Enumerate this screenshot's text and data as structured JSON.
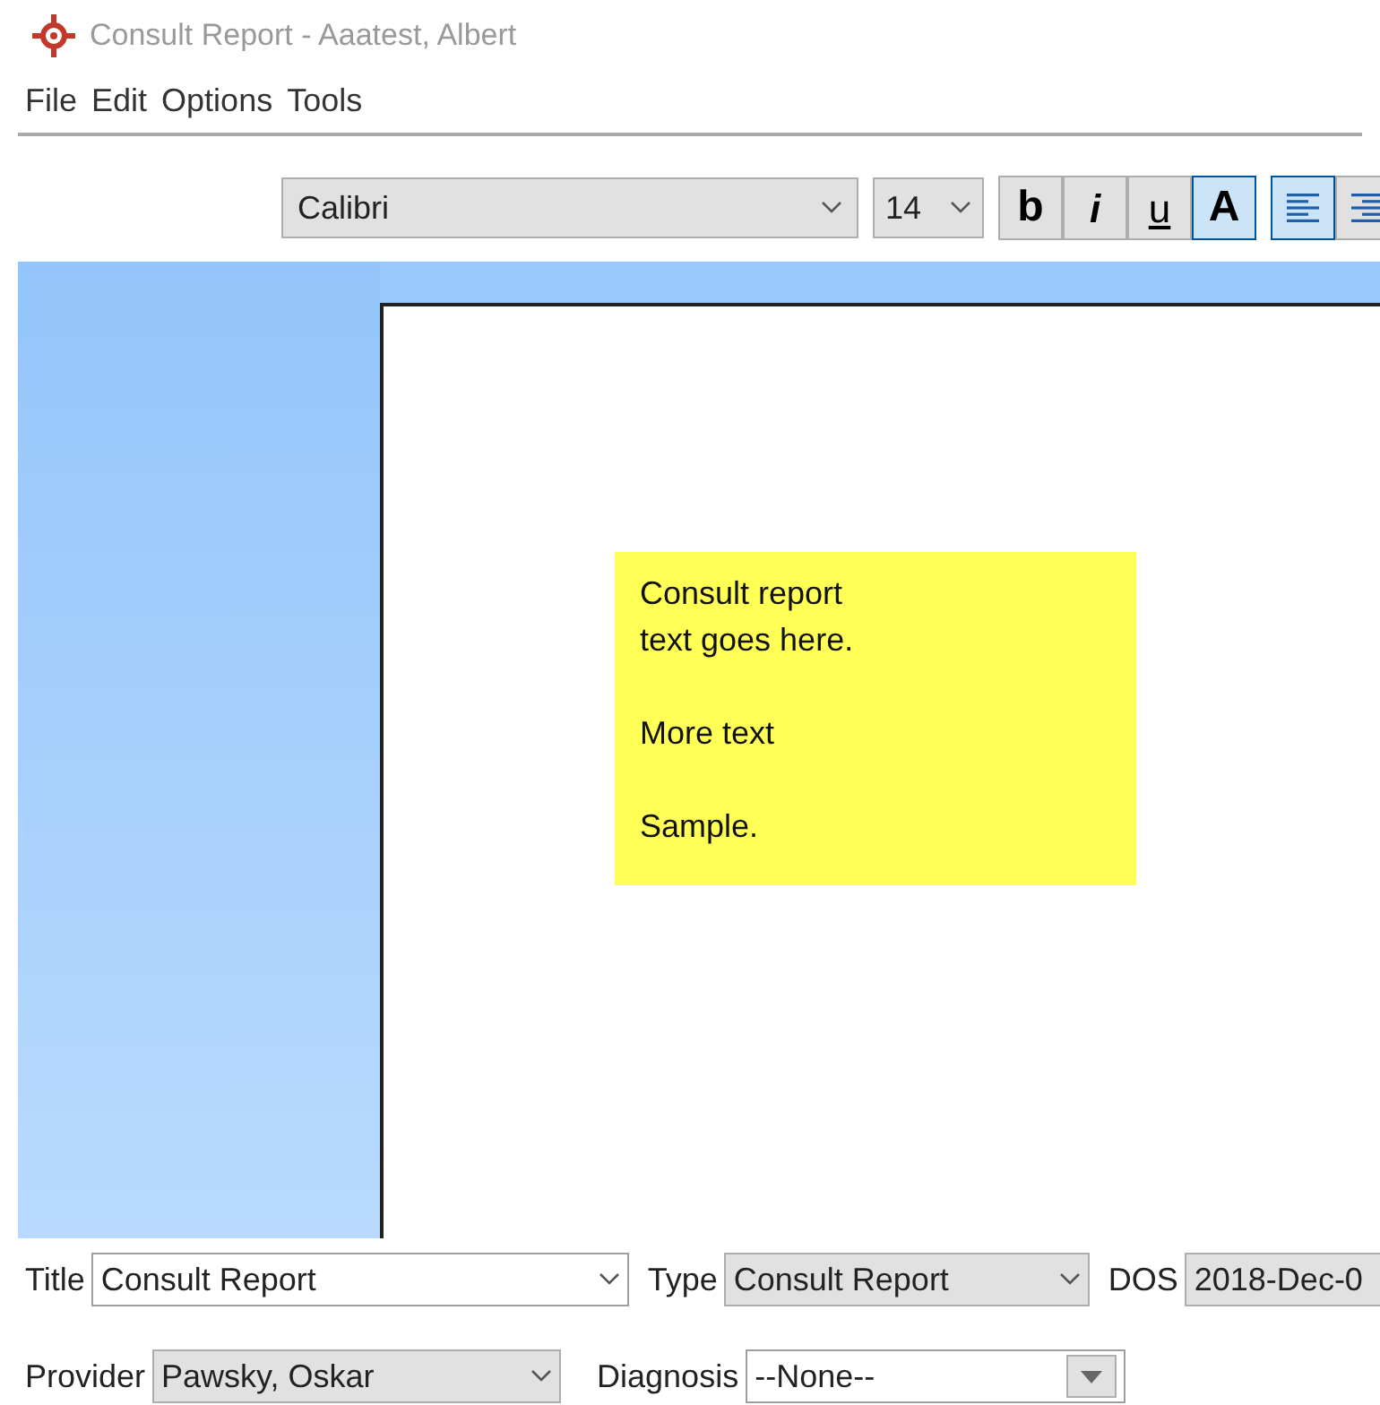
{
  "window": {
    "title": "Consult Report - Aaatest, Albert"
  },
  "menu": [
    "File",
    "Edit",
    "Options",
    "Tools"
  ],
  "toolbar": {
    "font": "Calibri",
    "size": "14",
    "format_buttons": [
      {
        "label": "b",
        "kind": "bold",
        "selected": false
      },
      {
        "label": "i",
        "kind": "italic",
        "selected": false
      },
      {
        "label": "u",
        "kind": "underline",
        "selected": false
      },
      {
        "label": "A",
        "kind": "plain",
        "selected": true
      }
    ],
    "align_buttons": [
      {
        "kind": "left",
        "selected": true
      },
      {
        "kind": "right",
        "selected": false
      }
    ]
  },
  "note": {
    "paragraphs": [
      "Consult report\ntext goes here.",
      "More text",
      "Sample."
    ]
  },
  "fields_row_1": [
    {
      "label": "Title",
      "value": "Consult Report",
      "disabled": false,
      "kind": "combo"
    },
    {
      "label": "Type",
      "value": "Consult Report",
      "disabled": true,
      "kind": "combo"
    },
    {
      "label": "DOS",
      "value": "2018-Dec-0",
      "disabled": true,
      "kind": "date"
    }
  ],
  "fields_row_2": [
    {
      "label": "Provider",
      "value": "Pawsky, Oskar",
      "disabled": true,
      "kind": "combo"
    },
    {
      "label": "Diagnosis",
      "value": "--None--",
      "disabled": false,
      "kind": "dropdown"
    }
  ]
}
